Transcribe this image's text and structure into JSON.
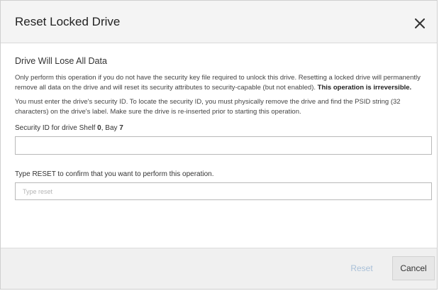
{
  "dialog": {
    "title": "Reset Locked Drive",
    "close_icon": "close-icon",
    "subtitle": "Drive Will Lose All Data",
    "para1_text": "Only perform this operation if you do not have the security key file required to unlock this drive. Resetting a locked drive will permanently remove all data on the drive and will reset its security attributes to security-capable (but not enabled). ",
    "para1_bold": "This operation is irreversible.",
    "para2_text": "You must enter the drive's security ID. To locate the security ID, you must physically remove the drive and find the PSID string (32 characters) on the drive's label. Make sure the drive is re-inserted prior to starting this operation.",
    "security_label_prefix": "Security ID for drive Shelf ",
    "security_shelf": "0",
    "security_label_mid": ", Bay ",
    "security_bay": "7",
    "security_value": "",
    "confirm_label": "Type RESET to confirm that you want to perform this operation.",
    "confirm_placeholder": "Type reset",
    "confirm_value": "",
    "reset_label": "Reset",
    "cancel_label": "Cancel"
  },
  "colors": {
    "header_bg": "#f4f4f4",
    "footer_bg": "#f0f0f0",
    "disabled_text": "#a9c0d8"
  }
}
